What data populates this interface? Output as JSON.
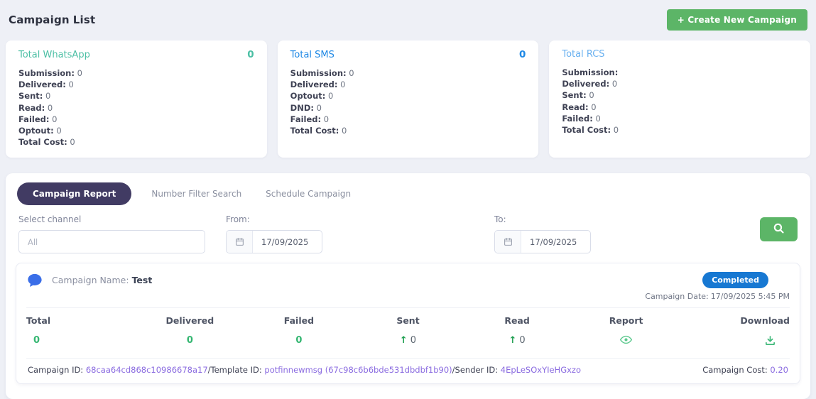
{
  "page": {
    "title_bold": "Campaign",
    "title_rest": "List"
  },
  "header": {
    "create_button_label": "+ Create New Campaign"
  },
  "colors": {
    "accent_green": "#5cb567",
    "active_tab": "#413b63",
    "badge_blue": "#1778d2",
    "value_green": "#34b671",
    "link_purple": "#8a6be0"
  },
  "cards": [
    {
      "title": "Total WhatsApp",
      "count": "0",
      "accent": "#4bbfa4",
      "stats": [
        {
          "label": "Submission:",
          "value": "0"
        },
        {
          "label": "Delivered:",
          "value": "0"
        },
        {
          "label": "Sent:",
          "value": "0"
        },
        {
          "label": "Read:",
          "value": "0"
        },
        {
          "label": "Failed:",
          "value": "0"
        },
        {
          "label": "Optout:",
          "value": "0"
        },
        {
          "label": "Total Cost:",
          "value": "0"
        }
      ]
    },
    {
      "title": "Total SMS",
      "count": "0",
      "accent": "#1e88e5",
      "stats": [
        {
          "label": "Submission:",
          "value": "0"
        },
        {
          "label": "Delivered:",
          "value": "0"
        },
        {
          "label": "Optout:",
          "value": "0"
        },
        {
          "label": "DND:",
          "value": "0"
        },
        {
          "label": "Failed:",
          "value": "0"
        },
        {
          "label": "Total Cost:",
          "value": "0"
        }
      ]
    },
    {
      "title": "Total RCS",
      "count": "",
      "accent": "#6ab1f0",
      "stats": [
        {
          "label": "Submission:",
          "value": ""
        },
        {
          "label": "Delivered:",
          "value": "0"
        },
        {
          "label": "Sent:",
          "value": "0"
        },
        {
          "label": "Read:",
          "value": "0"
        },
        {
          "label": "Failed:",
          "value": "0"
        },
        {
          "label": "Total Cost:",
          "value": "0"
        }
      ]
    }
  ],
  "tabs": [
    {
      "label": "Campaign Report",
      "active": true
    },
    {
      "label": "Number Filter Search",
      "active": false
    },
    {
      "label": "Schedule Campaign",
      "active": false
    }
  ],
  "filters": {
    "channel_label": "Select channel",
    "channel_value": "All",
    "from_label": "From:",
    "from_value": "17/09/2025",
    "to_label": "To:",
    "to_value": "17/09/2025"
  },
  "campaign": {
    "name_label": "Campaign Name:",
    "name": "Test",
    "status": "Completed",
    "date_label": "Campaign Date:",
    "date": "17/09/2025 5:45 PM",
    "columns": [
      "Total",
      "Delivered",
      "Failed",
      "Sent",
      "Read",
      "Report",
      "Download"
    ],
    "values": {
      "total": "0",
      "delivered": "0",
      "failed": "0",
      "sent": "0",
      "read": "0"
    },
    "arrow_glyph": "↑",
    "footer": {
      "campaign_id_label": "Campaign ID: ",
      "campaign_id": "68caa64cd868c10986678a17",
      "template_id_label": "/Template ID: ",
      "template_id": "potfinnewmsg (67c98c6b6bde531dbdbf1b90)",
      "sender_id_label": "/Sender ID: ",
      "sender_id": "4EpLeSOxYIeHGxzo",
      "cost_label": "Campaign Cost: ",
      "cost": "0.20"
    }
  },
  "icons": {
    "calendar": "calendar-icon",
    "search": "search-icon",
    "chat_bubble": "chat-bubble-icon",
    "eye": "eye-icon",
    "download": "download-icon"
  }
}
